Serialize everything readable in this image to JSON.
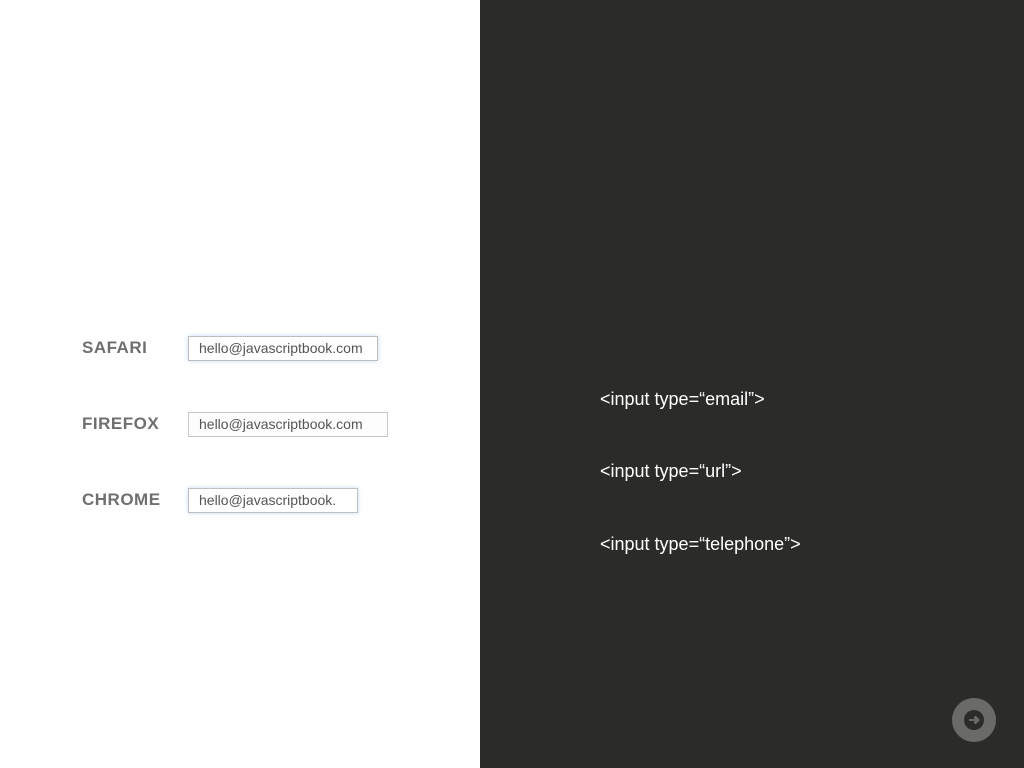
{
  "left": {
    "rows": [
      {
        "label": "SAFARI",
        "value": "hello@javascriptbook.com",
        "klass": "safari"
      },
      {
        "label": "FIREFOX",
        "value": "hello@javascriptbook.com",
        "klass": "firefox"
      },
      {
        "label": "CHROME",
        "value": "hello@javascriptbook.",
        "klass": "chrome"
      }
    ]
  },
  "right": {
    "code": [
      "<input type=“email”>",
      "<input type=“url”>",
      "<input type=“telephone”>"
    ]
  },
  "nav": {
    "next": "next"
  }
}
